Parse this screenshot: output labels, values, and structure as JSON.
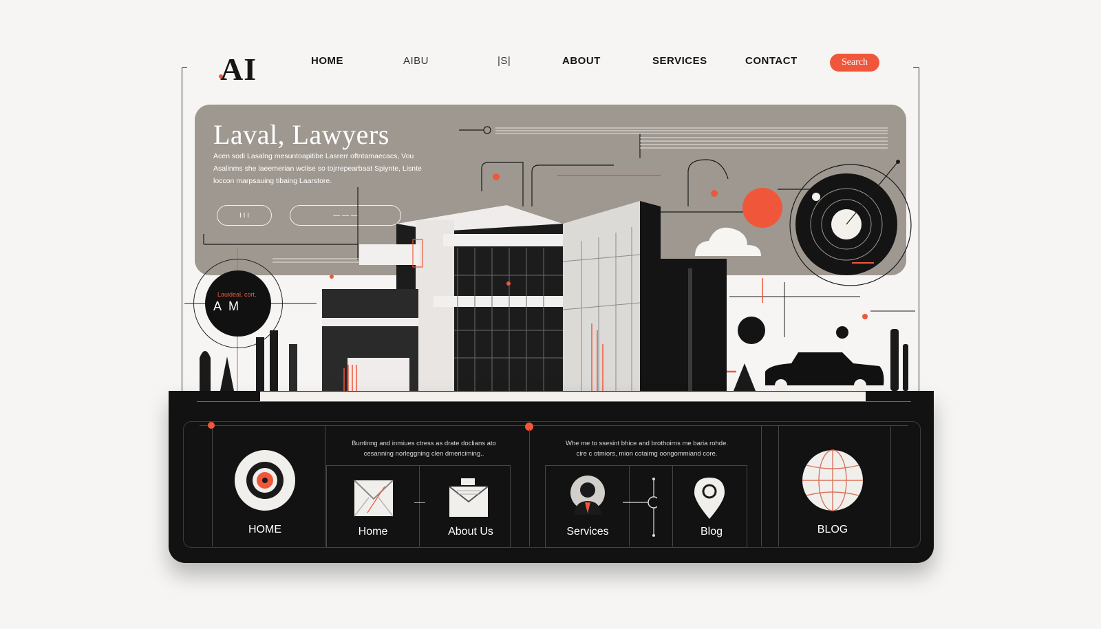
{
  "header": {
    "logo": "AI",
    "nav": [
      {
        "label": "HOME",
        "style": "bold"
      },
      {
        "label": "AIBU",
        "style": "light"
      },
      {
        "label": "|S|",
        "style": "light"
      },
      {
        "label": "ABOUT",
        "style": "bold"
      },
      {
        "label": "SERVICES",
        "style": "bold"
      },
      {
        "label": "CONTACT",
        "style": "bold"
      }
    ],
    "search_label": "Search"
  },
  "hero": {
    "title": "Laval, Lawyers",
    "description_lines": [
      "Acen sodi Lasalng mesuntoapitibe Lasrerr oftntamaecacs, Vou",
      "Asalinms she laeemerian wclise so tojrrepearbaat Spiynte, Lisnte",
      "loccon marpsauing tibaing Laarstore."
    ],
    "button_primary": "I I I",
    "button_secondary": "— — —"
  },
  "badge": {
    "subtitle": "Lauideal, cort.",
    "title": "A M"
  },
  "colors": {
    "accent": "#f0573a",
    "hero_bg": "#9e9890",
    "panel_bg": "#121212"
  },
  "panel": {
    "text_left": [
      "Buntinng and inmiues ctress as drate doclians ato",
      "cesanning norleggning clen dmericiming.."
    ],
    "text_right": [
      "Whe me to ssesint bhice and brothoirns me baria rohde.",
      "cire c otmiors, mion cotaimg oongommiand core."
    ],
    "features": [
      {
        "label": "HOME",
        "icon": "target-icon"
      },
      {
        "label": "Home",
        "icon": "envelope-icon"
      },
      {
        "label": "About Us",
        "icon": "inbox-mail-icon"
      },
      {
        "label": "Services",
        "icon": "person-icon"
      },
      {
        "label": "Blog",
        "icon": "map-pin-icon"
      },
      {
        "label": "BLOG",
        "icon": "globe-icon"
      }
    ]
  }
}
